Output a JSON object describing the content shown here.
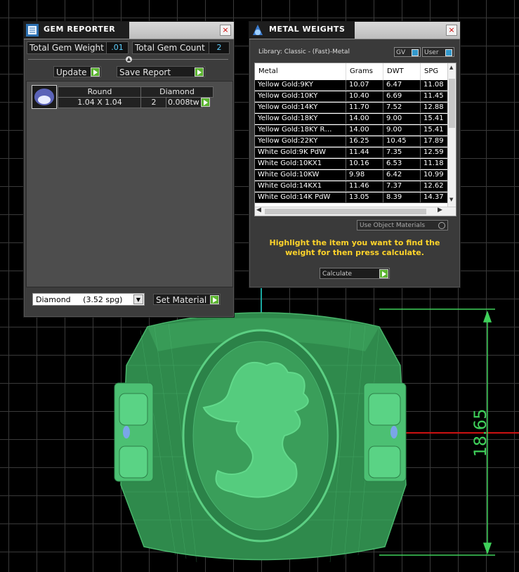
{
  "gem_reporter": {
    "title": "GEM REPORTER",
    "close": "×",
    "total_gem_weight_label": "Total Gem Weight",
    "total_gem_weight_value": ".01",
    "total_gem_count_label": "Total Gem Count",
    "total_gem_count_value": "2",
    "update_label": "Update",
    "save_report_label": "Save Report",
    "table": {
      "headers": [
        "Round",
        "Diamond"
      ],
      "size": "1.04 X 1.04",
      "count": "2",
      "weight": "0.008tw"
    },
    "material_select": "Diamond     (3.52 spg)",
    "set_material_label": "Set Material"
  },
  "metal_weights": {
    "title": "METAL WEIGHTS",
    "close": "×",
    "library": "Library: Classic - (Fast)-Metal",
    "toggle_gv": "GV",
    "toggle_user": "User",
    "columns": [
      "Metal",
      "Grams",
      "DWT",
      "SPG"
    ],
    "rows": [
      [
        "Yellow Gold:9KY",
        "10.07",
        "6.47",
        "11.08"
      ],
      [
        "Yellow Gold:10KY",
        "10.40",
        "6.69",
        "11.45"
      ],
      [
        "Yellow Gold:14KY",
        "11.70",
        "7.52",
        "12.88"
      ],
      [
        "Yellow Gold:18KY",
        "14.00",
        "9.00",
        "15.41"
      ],
      [
        "Yellow Gold:18KY R…",
        "14.00",
        "9.00",
        "15.41"
      ],
      [
        "Yellow Gold:22KY",
        "16.25",
        "10.45",
        "17.89"
      ],
      [
        "White Gold:9K PdW",
        "11.44",
        "7.35",
        "12.59"
      ],
      [
        "White Gold:10KX1",
        "10.16",
        "6.53",
        "11.18"
      ],
      [
        "White Gold:10KW",
        "9.98",
        "6.42",
        "10.99"
      ],
      [
        "White Gold:14KX1",
        "11.46",
        "7.37",
        "12.62"
      ],
      [
        "White Gold:14K PdW",
        "13.05",
        "8.39",
        "14.37"
      ]
    ],
    "use_object_materials": "Use Object Materials",
    "hint": "Highlight the item you want to find the weight for then press calculate.",
    "calculate_label": "Calculate"
  },
  "viewport": {
    "dimension_label": "18.65",
    "colors": {
      "ring": "#3fae62",
      "ring_light": "#52c878",
      "dimension": "#3fd15a",
      "axis_red": "#cc1111",
      "axis_teal": "#1aa7a0"
    }
  }
}
